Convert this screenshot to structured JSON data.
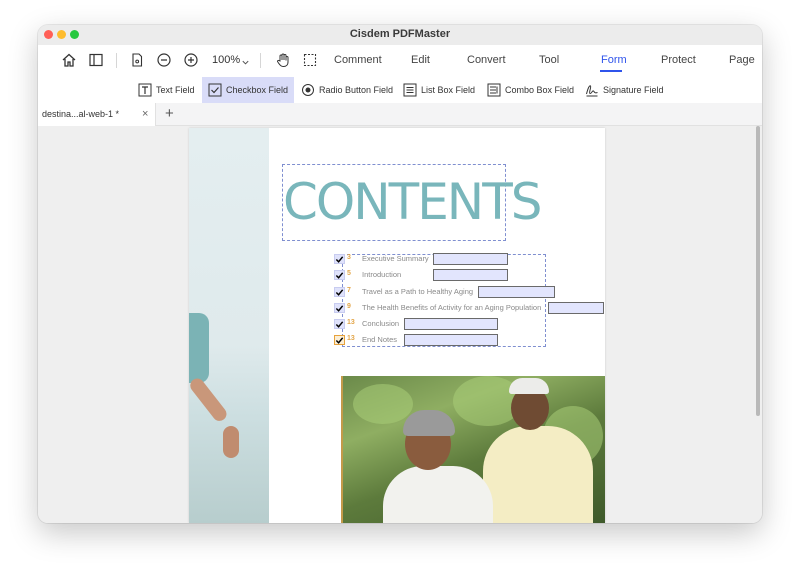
{
  "window": {
    "title": "Cisdem PDFMaster"
  },
  "toolbar": {
    "zoom": "100%",
    "menu": [
      {
        "label": "Comment",
        "active": false
      },
      {
        "label": "Edit",
        "active": false
      },
      {
        "label": "Convert",
        "active": false
      },
      {
        "label": "Tool",
        "active": false
      },
      {
        "label": "Form",
        "active": true
      },
      {
        "label": "Protect",
        "active": false
      },
      {
        "label": "Page",
        "active": false
      }
    ],
    "icons": [
      "home-icon",
      "sidebar-toggle-icon",
      "page-view-icon",
      "zoom-out-icon",
      "zoom-in-icon",
      "hand-tool-icon",
      "marquee-select-icon"
    ]
  },
  "form_tools": [
    {
      "label": "Text Field",
      "icon": "text-field-icon",
      "active": false
    },
    {
      "label": "Checkbox Field",
      "icon": "checkbox-field-icon",
      "active": true
    },
    {
      "label": "Radio Button Field",
      "icon": "radio-button-icon",
      "active": false
    },
    {
      "label": "List Box Field",
      "icon": "list-box-icon",
      "active": false
    },
    {
      "label": "Combo Box Field",
      "icon": "combo-box-icon",
      "active": false
    },
    {
      "label": "Signature Field",
      "icon": "signature-icon",
      "active": false
    }
  ],
  "tabs": [
    {
      "label": "destina...al-web-1 *",
      "close": "×"
    }
  ],
  "tab_add": "+",
  "document": {
    "heading": "CONTENTS",
    "toc": [
      {
        "num": "3",
        "label": "Executive Summary"
      },
      {
        "num": "5",
        "label": "Introduction"
      },
      {
        "num": "7",
        "label": "Travel as a Path to Healthy Aging"
      },
      {
        "num": "9",
        "label": "The Health Benefits of Activity for an Aging Population"
      },
      {
        "num": "13",
        "label": "Conclusion"
      },
      {
        "num": "13",
        "label": "End Notes"
      }
    ]
  },
  "colors": {
    "accent": "#2f54eb",
    "active_tool_bg": "#d9dcf8",
    "field_fill": "#e2e5fd",
    "heading": "#79b6bb",
    "toc_num": "#e3a64a"
  }
}
